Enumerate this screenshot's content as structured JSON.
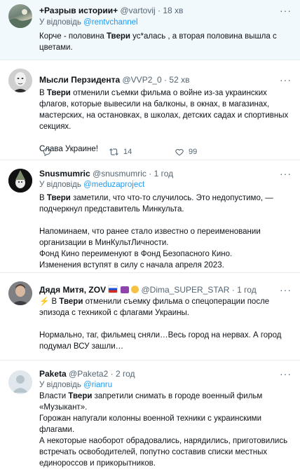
{
  "tweets": [
    {
      "name": "+Разрыв истории+",
      "handle": "@vartovij",
      "time": "18 хв",
      "reply_prefix": "У відповідь",
      "reply_to": "@rentvchannel",
      "body": [
        [
          "Корче - половина ",
          "Твери",
          " ус*алась , а вторая половина вышла с цветами."
        ]
      ]
    },
    {
      "name": "Мысли Перзидента",
      "handle": "@VVP2_0",
      "time": "52 хв",
      "body": [
        [
          "В ",
          "Твери",
          " отменили съемки фильма о войне из-за  украинских флагов, которые вывесили на балконы, в окнах, в магазинах, мастерских, на остановках, в школах, детских садах и спортивных секциях."
        ],
        [
          "Слава Украине!"
        ]
      ],
      "actions": {
        "replies": "",
        "retweets": "14",
        "likes": "99"
      }
    },
    {
      "name": "Snusmumric",
      "handle": "@snusmumric",
      "time": "1 год",
      "reply_prefix": "У відповідь",
      "reply_to": "@meduzaproject",
      "body": [
        [
          "В ",
          "Твери",
          " заметили, что что-то случилось. Это недопустимо, — подчеркнул представитель Минкульта."
        ],
        [
          "Напоминаем, что ранее стало известно о переименовании организации в МинКультЛичности."
        ],
        [
          "Фонд Кино переименуют в Фонд Безопасного Кино."
        ],
        [
          "Изменения вступят в силу с начала апреля 2023."
        ]
      ]
    },
    {
      "name": "Дядя Митя, ZOV",
      "handle": "@Dima_SUPER_STAR",
      "time": "1 год",
      "body": [
        [
          "⚡ В ",
          "Твери",
          " отменили съемку фильма о спецоперации после эпизода с техникой с флагами Украины."
        ],
        [
          "Нормально, таг, фильмец сняли…Весь город на нервах. А город подумал ВСУ зашли…"
        ]
      ]
    },
    {
      "name": "Paketa",
      "handle": "@Paketa2",
      "time": "2 год",
      "reply_prefix": "У відповідь",
      "reply_to": "@rianru",
      "body": [
        [
          "Власти ",
          "Твери",
          " запретили снимать в городе военный фильм «Музыкант»."
        ],
        [
          " Горожан напугали колонны военной техники с украинскими флагами."
        ],
        [
          "А некоторые наоборот обрадовались, нарядились, приготовились встречать освободителей, попутно составив списки местных единороссов и прикорытников."
        ]
      ]
    }
  ],
  "icons": {
    "more": "more-horizontal-icon",
    "reply": "reply-icon",
    "retweet": "retweet-icon",
    "like": "heart-icon"
  },
  "colors": {
    "link": "#1d9bf0",
    "muted": "#536471",
    "highlight_bg": "#f2f9fd"
  }
}
